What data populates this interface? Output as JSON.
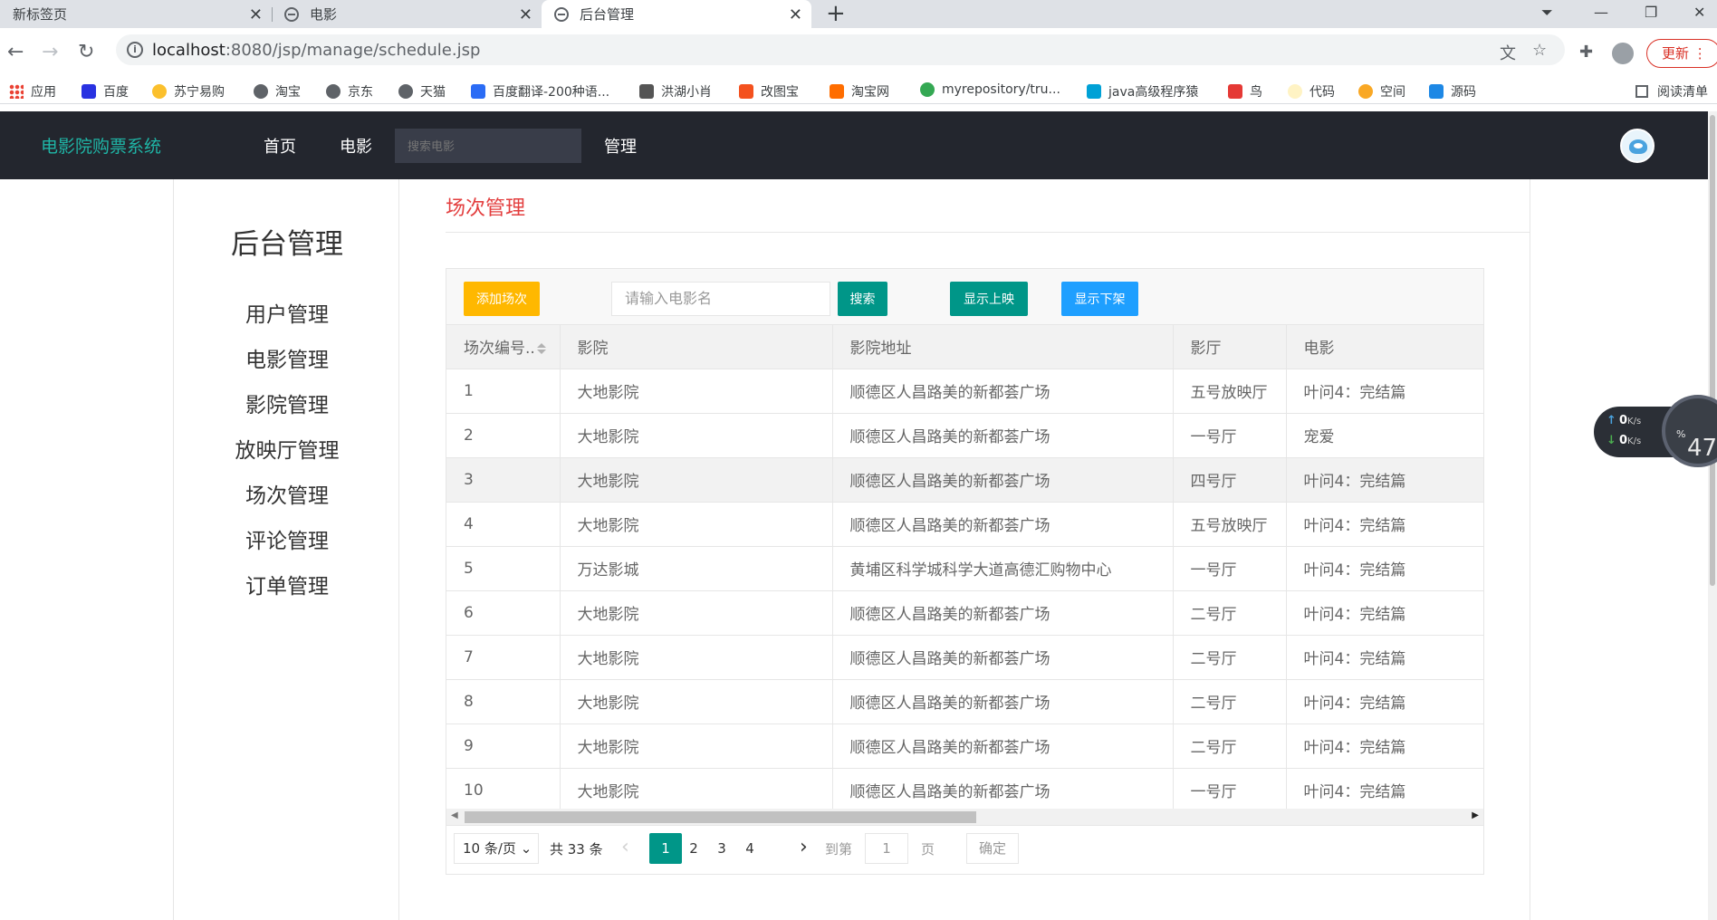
{
  "browser": {
    "tabs": [
      {
        "label": "新标签页",
        "active": false
      },
      {
        "label": "电影",
        "active": false
      },
      {
        "label": "后台管理",
        "active": true
      }
    ],
    "new_tab": "+",
    "url_host": "localhost",
    "url_path": ":8080/jsp/manage/schedule.jsp",
    "update_label": "更新",
    "bookmarks": [
      "应用",
      "百度",
      "苏宁易购",
      "淘宝",
      "京东",
      "天猫",
      "百度翻译-200种语...",
      "洪湖小肖",
      "改图宝",
      "淘宝网",
      "myrepository/tru...",
      "java高级程序猿",
      "鸟",
      "代码",
      "空间",
      "源码"
    ],
    "reading_list": "阅读清单"
  },
  "app": {
    "brand": "电影院购票系统",
    "nav": [
      "首页",
      "电影",
      "管理"
    ],
    "search_placeholder": "搜索电影"
  },
  "sidebar": {
    "title": "后台管理",
    "items": [
      "用户管理",
      "电影管理",
      "影院管理",
      "放映厅管理",
      "场次管理",
      "评论管理",
      "订单管理"
    ]
  },
  "main": {
    "title": "场次管理",
    "toolbar": {
      "add_label": "添加场次",
      "search_placeholder": "请输入电影名",
      "search_label": "搜索",
      "show_on_label": "显示上映",
      "show_off_label": "显示下架"
    },
    "table": {
      "columns": [
        "场次编号..",
        "影院",
        "影院地址",
        "影厅",
        "电影"
      ],
      "rows": [
        [
          "1",
          "大地影院",
          "顺德区人昌路美的新都荟广场",
          "五号放映厅",
          "叶问4：完结篇"
        ],
        [
          "2",
          "大地影院",
          "顺德区人昌路美的新都荟广场",
          "一号厅",
          "宠爱"
        ],
        [
          "3",
          "大地影院",
          "顺德区人昌路美的新都荟广场",
          "四号厅",
          "叶问4：完结篇"
        ],
        [
          "4",
          "大地影院",
          "顺德区人昌路美的新都荟广场",
          "五号放映厅",
          "叶问4：完结篇"
        ],
        [
          "5",
          "万达影城",
          "黄埔区科学城科学大道高德汇购物中心",
          "一号厅",
          "叶问4：完结篇"
        ],
        [
          "6",
          "大地影院",
          "顺德区人昌路美的新都荟广场",
          "二号厅",
          "叶问4：完结篇"
        ],
        [
          "7",
          "大地影院",
          "顺德区人昌路美的新都荟广场",
          "二号厅",
          "叶问4：完结篇"
        ],
        [
          "8",
          "大地影院",
          "顺德区人昌路美的新都荟广场",
          "二号厅",
          "叶问4：完结篇"
        ],
        [
          "9",
          "大地影院",
          "顺德区人昌路美的新都荟广场",
          "二号厅",
          "叶问4：完结篇"
        ],
        [
          "10",
          "大地影院",
          "顺德区人昌路美的新都荟广场",
          "一号厅",
          "叶问4：完结篇"
        ]
      ]
    },
    "pager": {
      "page_size": "10 条/页",
      "total": "共 33 条",
      "pages": [
        "1",
        "2",
        "3",
        "4"
      ],
      "current": "1",
      "goto_label": "到第",
      "goto_value": "1",
      "page_label": "页",
      "confirm_label": "确定"
    }
  },
  "netwidget": {
    "up": "0",
    "down": "0",
    "unit": "K/s",
    "percent": "47",
    "percent_unit": "%"
  }
}
